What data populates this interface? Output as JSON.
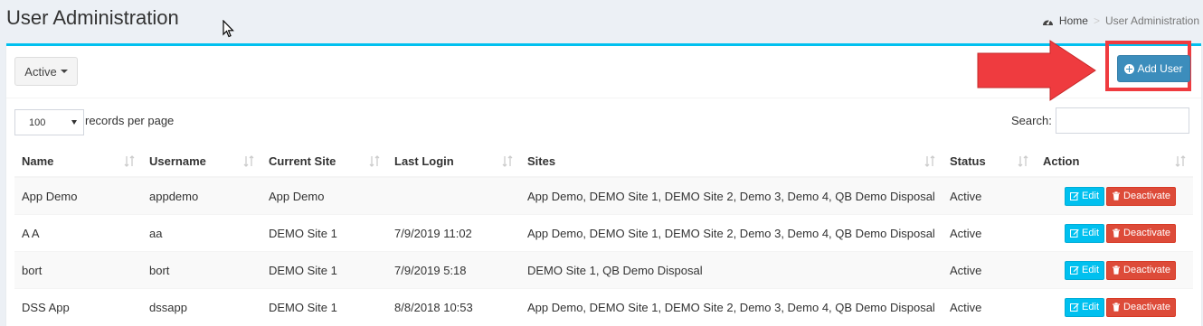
{
  "header": {
    "title": "User Administration"
  },
  "breadcrumb": {
    "home": "Home",
    "current": "User Administration"
  },
  "toolbar": {
    "filter_label": "Active",
    "add_user_label": "Add User"
  },
  "table_controls": {
    "page_size": "100",
    "records_label": "records per page",
    "search_label": "Search:",
    "search_value": ""
  },
  "columns": [
    "Name",
    "Username",
    "Current Site",
    "Last Login",
    "Sites",
    "Status",
    "Action"
  ],
  "rows": [
    {
      "name": "App Demo",
      "username": "appdemo",
      "current_site": "App Demo",
      "last_login": "",
      "sites": "App Demo, DEMO Site 1, DEMO Site 2, Demo 3, Demo 4, QB Demo Disposal",
      "status": "Active"
    },
    {
      "name": "A A",
      "username": "aa",
      "current_site": "DEMO Site 1",
      "last_login": "7/9/2019 11:02",
      "sites": "App Demo, DEMO Site 1, DEMO Site 2, Demo 3, Demo 4, QB Demo Disposal",
      "status": "Active"
    },
    {
      "name": "bort",
      "username": "bort",
      "current_site": "DEMO Site 1",
      "last_login": "7/9/2019 5:18",
      "sites": "DEMO Site 1, QB Demo Disposal",
      "status": "Active"
    },
    {
      "name": "DSS App",
      "username": "dssapp",
      "current_site": "DEMO Site 1",
      "last_login": "8/8/2018 10:53",
      "sites": "App Demo, DEMO Site 1, DEMO Site 2, Demo 3, Demo 4, QB Demo Disposal",
      "status": "Active"
    }
  ],
  "row_actions": {
    "edit_label": "Edit",
    "deactivate_label": "Deactivate"
  },
  "colors": {
    "accent": "#00c0ef",
    "primary": "#3c8dbc",
    "danger": "#dd4b39",
    "highlight": "#ef3b3f"
  },
  "icons": [
    "dashboard-icon",
    "plus-circle-icon",
    "edit-icon",
    "trash-icon",
    "sort-icon",
    "caret-down-icon",
    "cursor-icon",
    "arrow-icon"
  ]
}
